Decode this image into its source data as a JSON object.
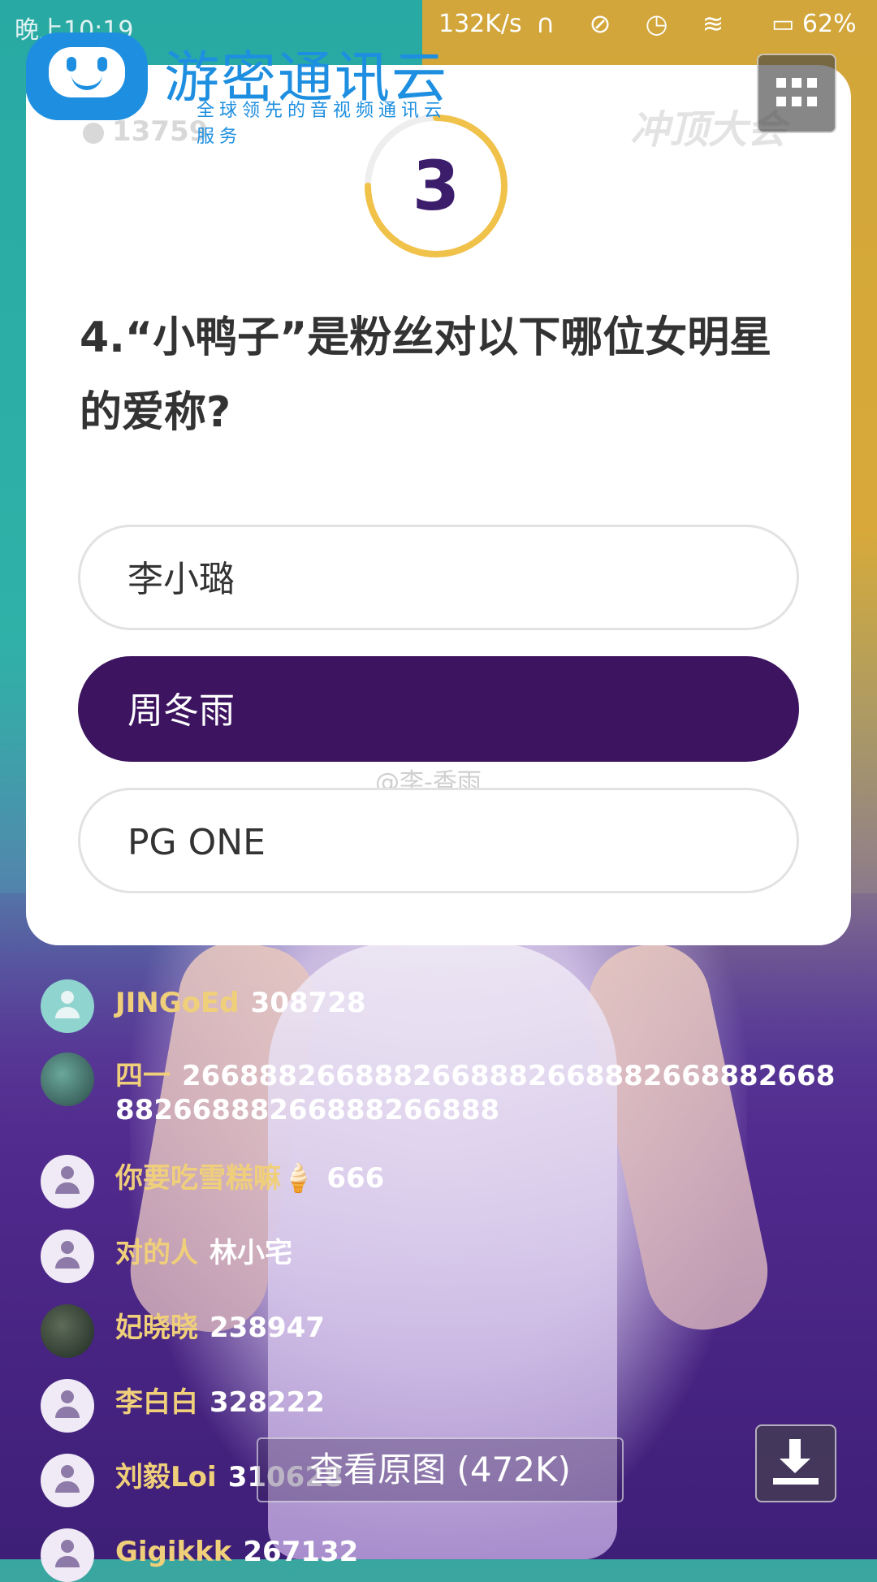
{
  "statusbar": {
    "time": "晚上10:19",
    "speed": "132K/s",
    "battery": "62%"
  },
  "watermark": {
    "title": "游密通讯云",
    "subtitle": "全球领先的音视频通讯云服务"
  },
  "quiz": {
    "viewer_count": "13759",
    "brand": "冲顶大会",
    "countdown": "3",
    "countdown_progress": 0.75,
    "question": "4.“小鸭子”是粉丝对以下哪位女明星的爱称?",
    "options": [
      {
        "label": "李小璐",
        "selected": false
      },
      {
        "label": "周冬雨",
        "selected": true
      },
      {
        "label": "PG ONE",
        "selected": false
      }
    ],
    "weibo_tag": "@李-香雨"
  },
  "comments": [
    {
      "user": "JINGoEd",
      "text": "308728"
    },
    {
      "user": "四一",
      "text": "266888266888266888266888266888266888266888266888266888"
    },
    {
      "user": "你要吃雪糕嘛🍦",
      "text": "666"
    },
    {
      "user": "对的人",
      "text": "林小宅"
    },
    {
      "user": "妃晓晓",
      "text": "238947"
    },
    {
      "user": "李白白",
      "text": "328222"
    },
    {
      "user": "刘毅Loi",
      "text": "310628"
    },
    {
      "user": "Gigikkk",
      "text": "267132"
    }
  ],
  "overlay": {
    "view_original": "查看原图 (472K)"
  },
  "colors": {
    "selected_option": "#3c145f",
    "timer_ring": "#f1c24a",
    "username": "#f0cf7a"
  }
}
